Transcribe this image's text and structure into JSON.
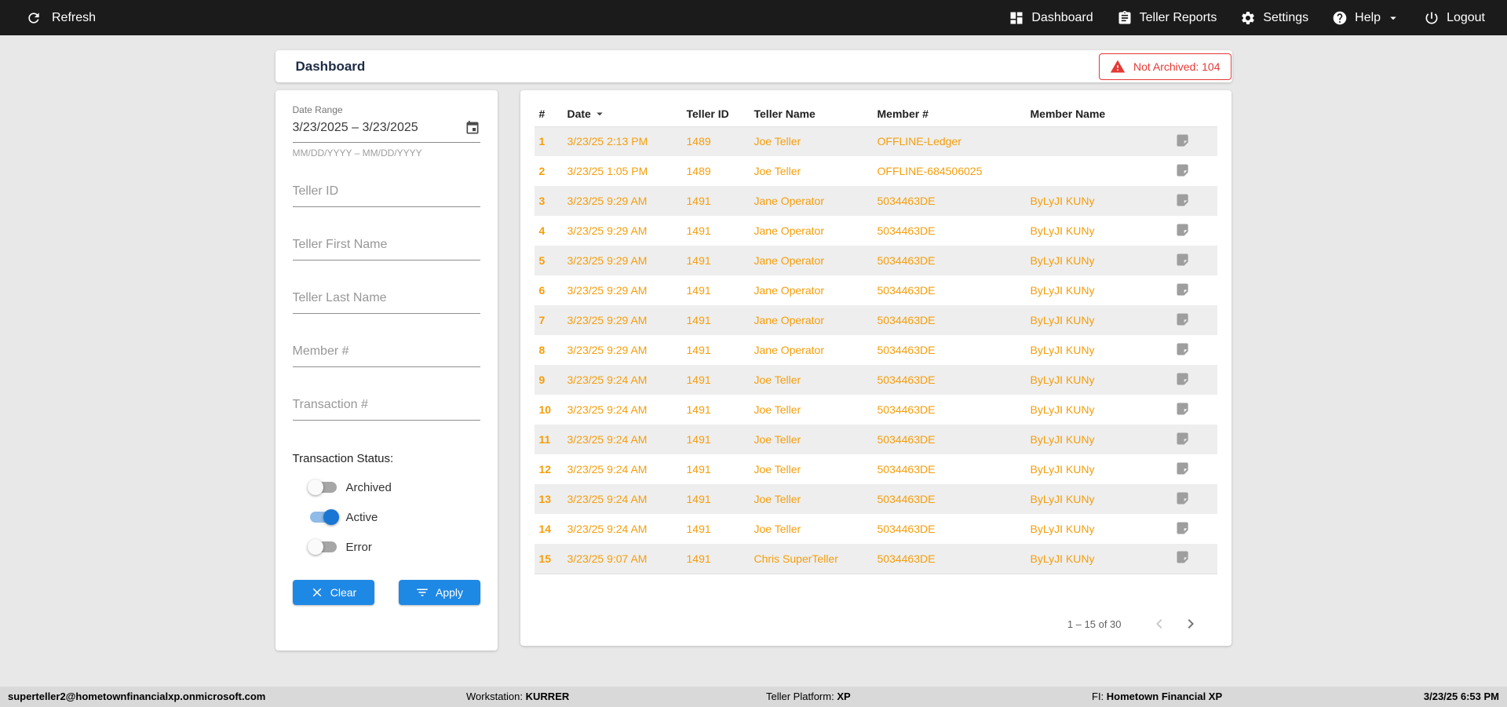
{
  "topbar": {
    "refresh_label": "Refresh",
    "items": [
      {
        "label": "Dashboard",
        "icon": "dashboard-icon"
      },
      {
        "label": "Teller Reports",
        "icon": "reports-icon"
      },
      {
        "label": "Settings",
        "icon": "settings-icon"
      },
      {
        "label": "Help",
        "icon": "help-icon",
        "has_chevron": true
      },
      {
        "label": "Logout",
        "icon": "power-icon"
      }
    ]
  },
  "header": {
    "title": "Dashboard",
    "not_archived_label": "Not Archived: 104"
  },
  "filters": {
    "date_range": {
      "label": "Date Range",
      "value": "3/23/2025 – 3/23/2025",
      "helper": "MM/DD/YYYY – MM/DD/YYYY"
    },
    "placeholders": {
      "teller_id": "Teller ID",
      "teller_first_name": "Teller First Name",
      "teller_last_name": "Teller Last Name",
      "member_number": "Member #",
      "transaction_number": "Transaction #"
    },
    "status": {
      "label": "Transaction Status:",
      "toggles": [
        {
          "label": "Archived",
          "on": false
        },
        {
          "label": "Active",
          "on": true
        },
        {
          "label": "Error",
          "on": false
        }
      ]
    },
    "clear_label": "Clear",
    "apply_label": "Apply"
  },
  "table": {
    "columns": [
      "#",
      "Date",
      "Teller ID",
      "Teller Name",
      "Member #",
      "Member Name"
    ],
    "rows": [
      {
        "num": "1",
        "date": "3/23/25 2:13 PM",
        "teller_id": "1489",
        "teller_name": "Joe Teller",
        "member_number": "OFFLINE-Ledger",
        "member_name": ""
      },
      {
        "num": "2",
        "date": "3/23/25 1:05 PM",
        "teller_id": "1489",
        "teller_name": "Joe Teller",
        "member_number": "OFFLINE-684506025",
        "member_name": ""
      },
      {
        "num": "3",
        "date": "3/23/25 9:29 AM",
        "teller_id": "1491",
        "teller_name": "Jane Operator",
        "member_number": "5034463DE",
        "member_name": "ByLyJI KUNy"
      },
      {
        "num": "4",
        "date": "3/23/25 9:29 AM",
        "teller_id": "1491",
        "teller_name": "Jane Operator",
        "member_number": "5034463DE",
        "member_name": "ByLyJI KUNy"
      },
      {
        "num": "5",
        "date": "3/23/25 9:29 AM",
        "teller_id": "1491",
        "teller_name": "Jane Operator",
        "member_number": "5034463DE",
        "member_name": "ByLyJI KUNy"
      },
      {
        "num": "6",
        "date": "3/23/25 9:29 AM",
        "teller_id": "1491",
        "teller_name": "Jane Operator",
        "member_number": "5034463DE",
        "member_name": "ByLyJI KUNy"
      },
      {
        "num": "7",
        "date": "3/23/25 9:29 AM",
        "teller_id": "1491",
        "teller_name": "Jane Operator",
        "member_number": "5034463DE",
        "member_name": "ByLyJI KUNy"
      },
      {
        "num": "8",
        "date": "3/23/25 9:29 AM",
        "teller_id": "1491",
        "teller_name": "Jane Operator",
        "member_number": "5034463DE",
        "member_name": "ByLyJI KUNy"
      },
      {
        "num": "9",
        "date": "3/23/25 9:24 AM",
        "teller_id": "1491",
        "teller_name": "Joe Teller",
        "member_number": "5034463DE",
        "member_name": "ByLyJI KUNy"
      },
      {
        "num": "10",
        "date": "3/23/25 9:24 AM",
        "teller_id": "1491",
        "teller_name": "Joe Teller",
        "member_number": "5034463DE",
        "member_name": "ByLyJI KUNy"
      },
      {
        "num": "11",
        "date": "3/23/25 9:24 AM",
        "teller_id": "1491",
        "teller_name": "Joe Teller",
        "member_number": "5034463DE",
        "member_name": "ByLyJI KUNy"
      },
      {
        "num": "12",
        "date": "3/23/25 9:24 AM",
        "teller_id": "1491",
        "teller_name": "Joe Teller",
        "member_number": "5034463DE",
        "member_name": "ByLyJI KUNy"
      },
      {
        "num": "13",
        "date": "3/23/25 9:24 AM",
        "teller_id": "1491",
        "teller_name": "Joe Teller",
        "member_number": "5034463DE",
        "member_name": "ByLyJI KUNy"
      },
      {
        "num": "14",
        "date": "3/23/25 9:24 AM",
        "teller_id": "1491",
        "teller_name": "Joe Teller",
        "member_number": "5034463DE",
        "member_name": "ByLyJI KUNy"
      },
      {
        "num": "15",
        "date": "3/23/25 9:07 AM",
        "teller_id": "1491",
        "teller_name": "Chris SuperTeller",
        "member_number": "5034463DE",
        "member_name": "ByLyJI KUNy"
      }
    ],
    "pagination": {
      "range_label": "1 – 15 of 30"
    }
  },
  "footer": {
    "email": "superteller2@hometownfinancialxp.onmicrosoft.com",
    "workstation_label": "Workstation:",
    "workstation_value": "KURRER",
    "platform_label": "Teller Platform:",
    "platform_value": "XP",
    "fi_label": "FI:",
    "fi_value": "Hometown Financial XP",
    "timestamp": "3/23/25 6:53 PM"
  },
  "colors": {
    "topbar_bg": "#1b1b1b",
    "accent_blue": "#1e88e5",
    "data_orange": "#f59e0b",
    "alert_red": "#e53935"
  }
}
